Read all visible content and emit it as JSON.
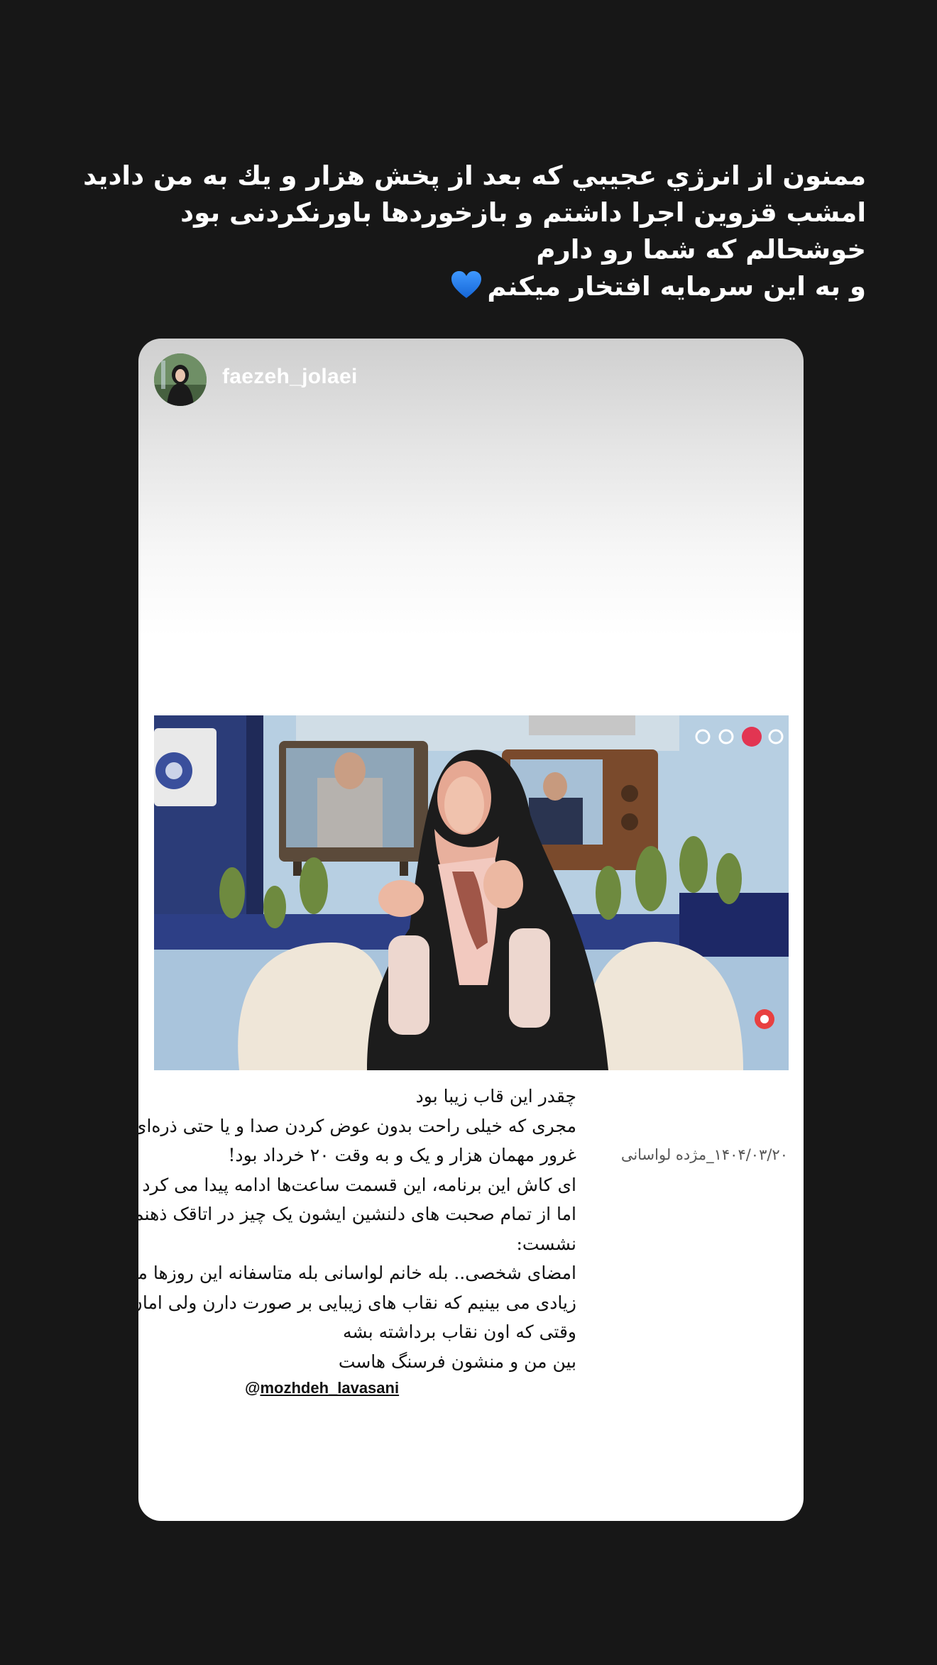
{
  "story_caption": {
    "lines": [
      "ممنون از انرژي عجيبي كه بعد از پخش هزار و يك به من داديد",
      "امشب قزوین اجرا داشتم و بازخوردها باورنکردنی بود",
      "خوشحالم که شما رو دارم",
      "و به این سرمایه افتخار میکنم"
    ],
    "emoji": "blue-heart"
  },
  "shared_post": {
    "username": "faezeh_jolaei",
    "avatar_icon": "profile-avatar",
    "text_lines": [
      "چقدر این قاب زیبا بود",
      "مجری که خیلی راحت بدون عوض کردن صدا و یا حتی ذره‌ای",
      "غرور مهمان هزار و یک و به وقت ۲۰ خرداد بود!",
      "ای کاش این برنامه، این قسمت ساعت‌ها ادامه پیدا می کرد",
      "اما از تمام صحبت های دلنشین ایشون یک چیز در اتاقک ذهنم",
      "نشست:",
      "امضای شخصی.. بله خانم لواسانی بله متاسفانه این روزها مجریان",
      "زیادی می بینیم که نقاب های زیبایی بر صورت دارن ولی امان از",
      "وقتی که اون نقاب برداشته بشه",
      "بین من و منشون فرسنگ هاست"
    ],
    "date_signature": "۱۴۰۴/۰۳/۲۰_مژده لواسانی",
    "mention_at": "@",
    "mention_handle": "mozhdeh_lavasani"
  },
  "colors": {
    "background": "#171717",
    "card": "#ffffff",
    "heart": "#1e7bf0"
  }
}
